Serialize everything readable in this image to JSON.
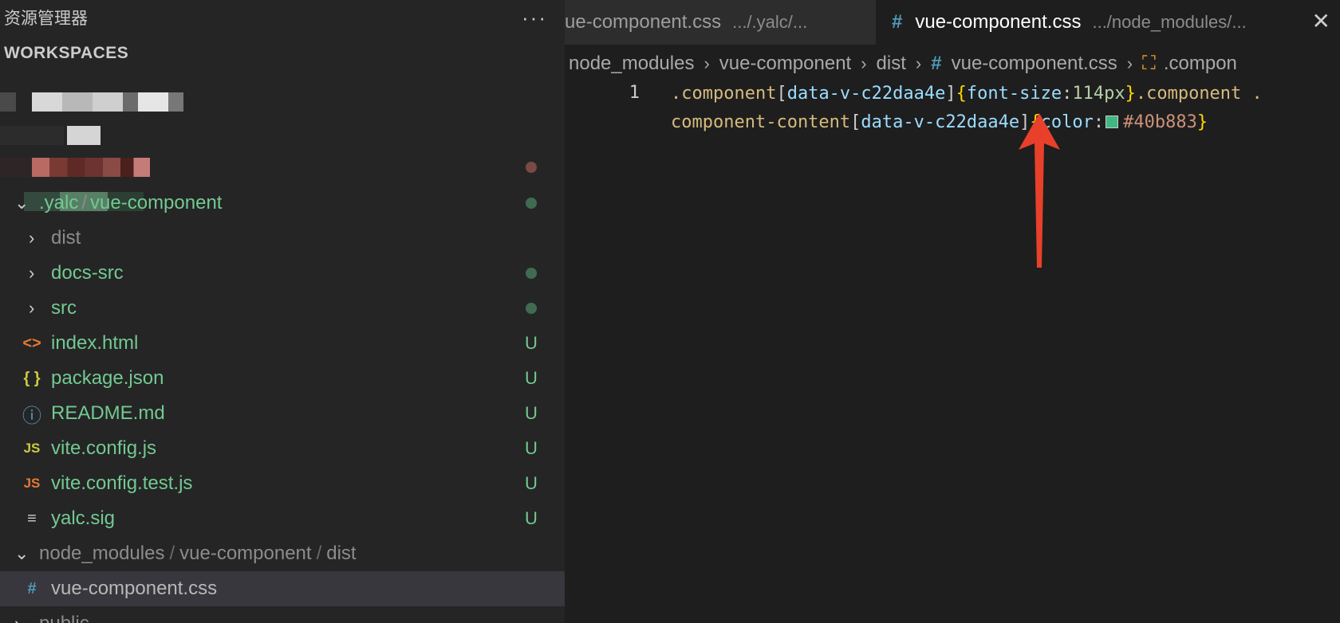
{
  "sidebar": {
    "title": "资源管理器",
    "more_icon": "···",
    "workspaces_label": "WORKSPACES",
    "yalc_folder": {
      "path1": ".yalc",
      "sep": "/",
      "path2": "vue-component"
    },
    "items": [
      {
        "name": "dist",
        "kind": "folder"
      },
      {
        "name": "docs-src",
        "kind": "folder"
      },
      {
        "name": "src",
        "kind": "folder"
      },
      {
        "name": "index.html",
        "icon": "<>",
        "badge": "U"
      },
      {
        "name": "package.json",
        "icon": "{ }",
        "badge": "U"
      },
      {
        "name": "README.md",
        "icon": "ⓘ",
        "badge": "U"
      },
      {
        "name": "vite.config.js",
        "icon": "JS",
        "badge": "U"
      },
      {
        "name": "vite.config.test.js",
        "icon": "JS",
        "badge": "U"
      },
      {
        "name": "yalc.sig",
        "icon": "≡",
        "badge": "U"
      }
    ],
    "node_folder": {
      "p1": "node_modules",
      "p2": "vue-component",
      "p3": "dist",
      "sep": "/"
    },
    "selected_file": {
      "name": "vue-component.css",
      "icon": "#"
    },
    "cut_item": "public"
  },
  "editor": {
    "tab1": {
      "name": "ue-component.css",
      "desc": ".../.yalc/..."
    },
    "tab2": {
      "name": "vue-component.css",
      "desc": ".../node_modules/...",
      "icon": "#"
    },
    "close_icon": "✕",
    "breadcrumb": {
      "b1": "node_modules",
      "b2": "vue-component",
      "b3": "dist",
      "b4": "vue-component.css",
      "b5": ".compon"
    },
    "line_number": "1",
    "code": {
      "l1_sel1": ".component",
      "l1_attr1": "data-v-c22daa4e",
      "l1_prop1": "font-size",
      "l1_val1": "114px",
      "l1_sel2": ".component .",
      "l2_sel": "component-content",
      "l2_attr": "data-v-c22daa4e",
      "l2_prop": "color",
      "l2_val": "#40b883"
    }
  },
  "colors": {
    "swatch": "#40b883",
    "arrow": "#e8402a"
  }
}
